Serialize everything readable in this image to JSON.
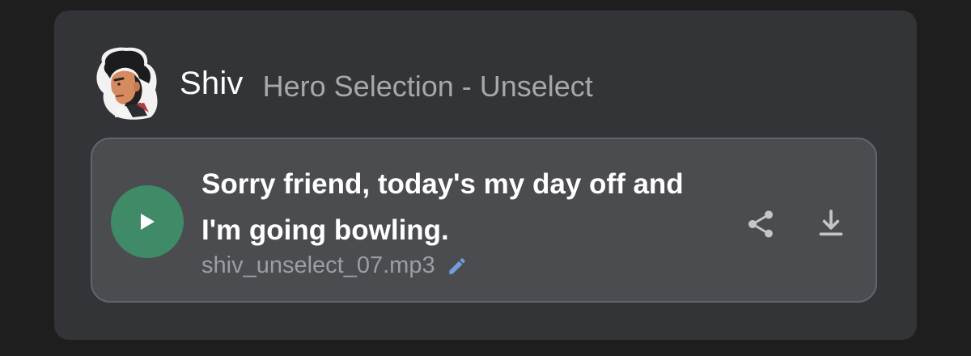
{
  "hero": {
    "name": "Shiv",
    "context": "Hero Selection - Unselect",
    "avatar_icon": "shiv-portrait-icon"
  },
  "clip": {
    "quote": "Sorry friend, today's my day off and I'm going bowling.",
    "filename": "shiv_unselect_07.mp3",
    "play_icon": "play-icon",
    "edit_icon": "pencil-icon",
    "share_icon": "share-icon",
    "download_icon": "download-icon"
  },
  "colors": {
    "page_background": "#1e1e1f",
    "card_background": "#323437",
    "clip_background": "#4a4c50",
    "play_button": "#3f8a67",
    "edit_icon": "#6f9fd8",
    "muted_text": "#a6a8ac",
    "icon_gray": "#c3c5c9"
  }
}
